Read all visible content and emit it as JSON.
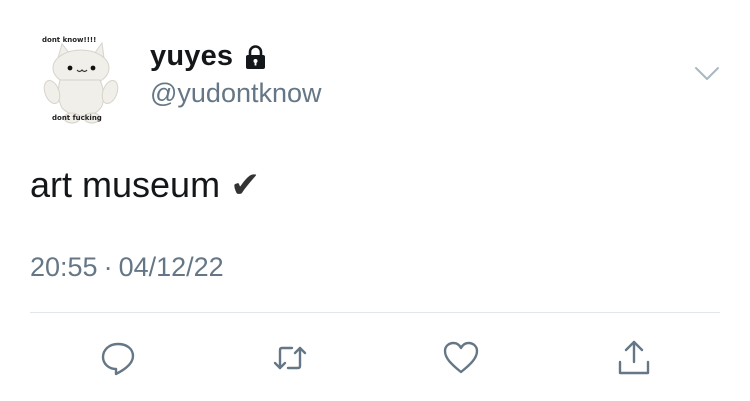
{
  "avatar": {
    "caption_top": "dont know!!!!",
    "caption_bottom": "dont fucking"
  },
  "user": {
    "display_name": "yuyes",
    "handle": "@yudontknow",
    "protected_icon": "lock-icon"
  },
  "tweet": {
    "text": "art museum",
    "emoji": "✔",
    "time": "20:55",
    "separator": "·",
    "date": "04/12/22"
  },
  "actions": [
    {
      "name": "reply",
      "icon": "comment-icon"
    },
    {
      "name": "retweet",
      "icon": "retweet-icon"
    },
    {
      "name": "like",
      "icon": "heart-icon"
    },
    {
      "name": "share",
      "icon": "share-icon"
    }
  ],
  "colors": {
    "text": "#14171a",
    "secondary": "#657786",
    "divider": "#e1e8ed"
  }
}
